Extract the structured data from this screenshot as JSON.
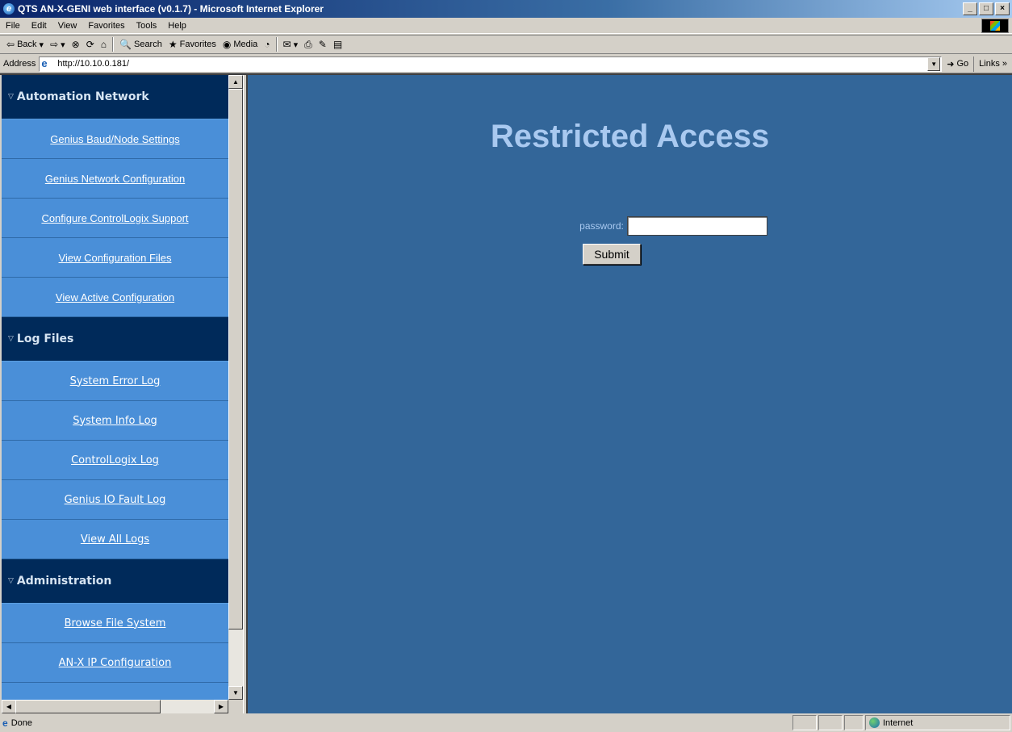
{
  "window": {
    "title": "QTS AN-X-GENI web interface (v0.1.7) - Microsoft Internet Explorer",
    "controls": {
      "minimize": "_",
      "maximize": "□",
      "close": "×"
    }
  },
  "menubar": {
    "items": [
      "File",
      "Edit",
      "View",
      "Favorites",
      "Tools",
      "Help"
    ]
  },
  "toolbar": {
    "back": "Back",
    "search": "Search",
    "favorites": "Favorites",
    "media": "Media"
  },
  "address": {
    "label": "Address",
    "url": "http://10.10.0.181/",
    "go": "Go",
    "links": "Links »"
  },
  "sidebar": {
    "sections": [
      {
        "title": "Automation Network",
        "items": [
          "Genius Baud/Node Settings",
          "Genius Network Configuration",
          "Configure ControlLogix Support",
          "View Configuration Files",
          "View Active Configuration"
        ]
      },
      {
        "title": "Log Files",
        "items": [
          "System Error Log",
          "System Info Log",
          "ControlLogix Log",
          "Genius IO Fault Log",
          "View All Logs"
        ]
      },
      {
        "title": "Administration",
        "items": [
          "Browse File System",
          "AN-X IP Configuration"
        ]
      }
    ]
  },
  "main": {
    "heading": "Restricted Access",
    "password_label": "password:",
    "password_value": "",
    "submit_label": "Submit"
  },
  "statusbar": {
    "status": "Done",
    "zone": "Internet"
  },
  "colors": {
    "page_bg": "#336699",
    "nav_header_bg": "#002a5a",
    "nav_item_bg": "#4a8fd8",
    "heading": "#a9c9f0"
  }
}
